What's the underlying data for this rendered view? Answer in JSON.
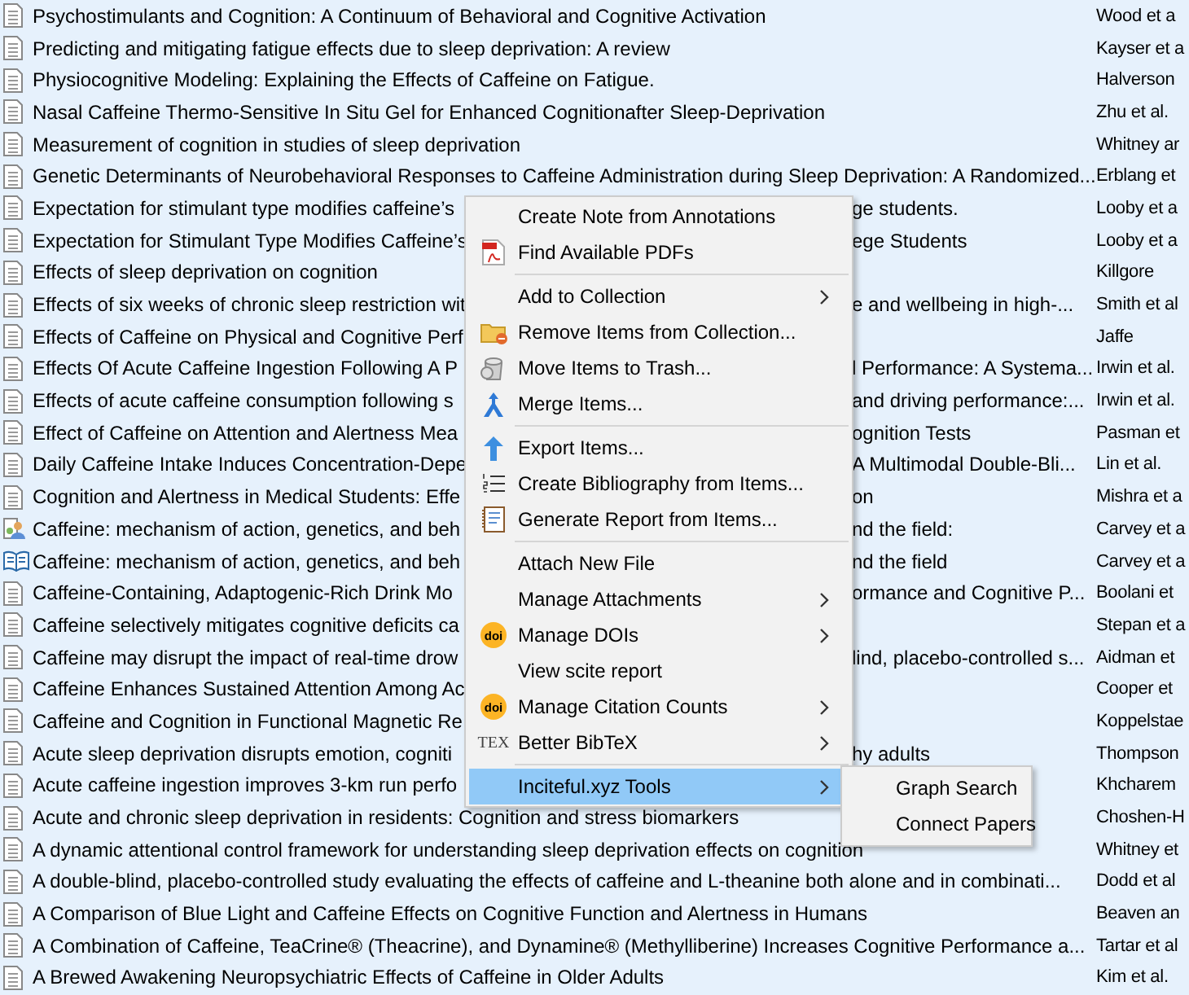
{
  "items": [
    {
      "kind": "document",
      "title": "Psychostimulants and Cognition: A Continuum of Behavioral and Cognitive Activation",
      "creator": "Wood et a"
    },
    {
      "kind": "document",
      "title": "Predicting and mitigating fatigue effects due to sleep deprivation: A review",
      "creator": "Kayser et a"
    },
    {
      "kind": "document",
      "title": "Physiocognitive Modeling: Explaining the Effects of Caffeine on Fatigue.",
      "creator": "Halverson"
    },
    {
      "kind": "document",
      "title": "Nasal Caffeine Thermo-Sensitive In Situ Gel for Enhanced Cognitionafter Sleep-Deprivation",
      "creator": "Zhu et al."
    },
    {
      "kind": "document",
      "title": "Measurement of cognition in studies of sleep deprivation",
      "creator": "Whitney ar"
    },
    {
      "kind": "document",
      "title": "Genetic Determinants of Neurobehavioral Responses to Caffeine Administration during Sleep Deprivation: A Randomized...",
      "creator": "Erblang et"
    },
    {
      "kind": "document",
      "title": "Expectation for stimulant type modifies caffeine’s",
      "title_tail": "ge students.",
      "creator": "Looby et a"
    },
    {
      "kind": "document",
      "title": "Expectation for Stimulant Type Modifies Caffeine’s",
      "title_tail": "ege Students",
      "creator": "Looby et a"
    },
    {
      "kind": "document",
      "title": "Effects of sleep deprivation on cognition",
      "creator": "Killgore"
    },
    {
      "kind": "document",
      "title": "Effects of six weeks of chronic sleep restriction wit",
      "title_tail": "e and wellbeing in high-...",
      "creator": "Smith et al"
    },
    {
      "kind": "document",
      "title": "Effects of Caffeine on Physical and Cognitive Perf",
      "creator": "Jaffe"
    },
    {
      "kind": "document",
      "title": "Effects Of Acute Caffeine Ingestion Following A P",
      "title_tail": "l Performance: A Systema...",
      "creator": "Irwin et al."
    },
    {
      "kind": "document",
      "title": "Effects of acute caffeine consumption following s",
      "title_tail": "and driving performance:...",
      "creator": "Irwin et al."
    },
    {
      "kind": "document",
      "title": "Effect of Caffeine on Attention and Alertness Mea",
      "title_tail": "ognition Tests",
      "creator": "Pasman et"
    },
    {
      "kind": "document",
      "title": "Daily Caffeine Intake Induces Concentration-Depe",
      "title_tail": "A Multimodal Double-Bli...",
      "creator": "Lin et al."
    },
    {
      "kind": "document",
      "title": "Cognition and Alertness in Medical Students: Effe",
      "title_tail": "on",
      "creator": "Mishra et a"
    },
    {
      "kind": "person",
      "title": "Caffeine: mechanism of action, genetics, and beh",
      "title_tail": "nd the field:",
      "creator": "Carvey et a"
    },
    {
      "kind": "book",
      "title": "Caffeine: mechanism of action, genetics, and beh",
      "title_tail": "nd the field",
      "creator": "Carvey et a"
    },
    {
      "kind": "document",
      "title": "Caffeine-Containing, Adaptogenic-Rich Drink Mo",
      "title_tail": "ormance and Cognitive P...",
      "creator": "Boolani et"
    },
    {
      "kind": "document",
      "title": "Caffeine selectively mitigates cognitive deficits ca",
      "creator": "Stepan et a"
    },
    {
      "kind": "document",
      "title": "Caffeine may disrupt the impact of real-time drow",
      "title_tail": "lind, placebo-controlled s...",
      "creator": "Aidman et"
    },
    {
      "kind": "document",
      "title": "Caffeine Enhances Sustained Attention Among Ac",
      "creator": "Cooper et"
    },
    {
      "kind": "document",
      "title": "Caffeine and Cognition in Functional Magnetic Re",
      "creator": "Koppelstae"
    },
    {
      "kind": "document",
      "title": "Acute sleep deprivation disrupts emotion, cogniti",
      "title_tail": "hy adults",
      "creator": "Thompson"
    },
    {
      "kind": "document",
      "title": "Acute caffeine ingestion improves 3-km run perfo",
      "creator": "Khcharem"
    },
    {
      "kind": "document",
      "title": "Acute and chronic sleep deprivation in residents: Cognition and stress biomarkers",
      "creator": "Choshen-H"
    },
    {
      "kind": "document",
      "title": "A dynamic attentional control framework for understanding sleep deprivation effects on cognition",
      "creator": "Whitney et"
    },
    {
      "kind": "document",
      "title": "A double-blind, placebo-controlled study evaluating the effects of caffeine and L-theanine both alone and in combinati...",
      "creator": "Dodd et al"
    },
    {
      "kind": "document",
      "title": "A Comparison of Blue Light and Caffeine Effects on Cognitive Function and Alertness in Humans",
      "creator": "Beaven an"
    },
    {
      "kind": "document",
      "title": "A Combination of Caffeine, TeaCrine® (Theacrine), and Dynamine® (Methylliberine) Increases Cognitive Performance a...",
      "creator": "Tartar et al"
    },
    {
      "kind": "document",
      "title": "A Brewed Awakening Neuropsychiatric Effects of Caffeine in Older Adults",
      "creator": "Kim et al."
    }
  ],
  "context_menu": [
    {
      "kind": "item",
      "label": "Create Note from Annotations",
      "submenu": false,
      "selected": false
    },
    {
      "kind": "item",
      "label": "Find Available PDFs",
      "submenu": false,
      "selected": false
    },
    {
      "kind": "separator"
    },
    {
      "kind": "item",
      "label": "Add to Collection",
      "submenu": true,
      "selected": false
    },
    {
      "kind": "item",
      "label": "Remove Items from Collection...",
      "submenu": false,
      "selected": false
    },
    {
      "kind": "item",
      "label": "Move Items to Trash...",
      "submenu": false,
      "selected": false
    },
    {
      "kind": "item",
      "label": "Merge Items...",
      "submenu": false,
      "selected": false
    },
    {
      "kind": "separator"
    },
    {
      "kind": "item",
      "label": "Export Items...",
      "submenu": false,
      "selected": false
    },
    {
      "kind": "item",
      "label": "Create Bibliography from Items...",
      "submenu": false,
      "selected": false
    },
    {
      "kind": "item",
      "label": "Generate Report from Items...",
      "submenu": false,
      "selected": false
    },
    {
      "kind": "separator"
    },
    {
      "kind": "item",
      "label": "Attach New File",
      "submenu": false,
      "selected": false
    },
    {
      "kind": "item",
      "label": "Manage Attachments",
      "submenu": true,
      "selected": false
    },
    {
      "kind": "item",
      "label": "Manage DOIs",
      "icon_text": "doi",
      "submenu": true,
      "selected": false
    },
    {
      "kind": "item",
      "label": "View scite report",
      "submenu": false,
      "selected": false
    },
    {
      "kind": "item",
      "label": "Manage Citation Counts",
      "icon_text": "doi",
      "submenu": true,
      "selected": false
    },
    {
      "kind": "item",
      "label": "Better BibTeX",
      "icon_text": "TEX",
      "submenu": true,
      "selected": false
    },
    {
      "kind": "separator"
    },
    {
      "kind": "item",
      "label": "Inciteful.xyz Tools",
      "submenu": true,
      "selected": true
    }
  ],
  "submenu": [
    {
      "label": "Graph Search"
    },
    {
      "label": "Connect Papers"
    }
  ]
}
